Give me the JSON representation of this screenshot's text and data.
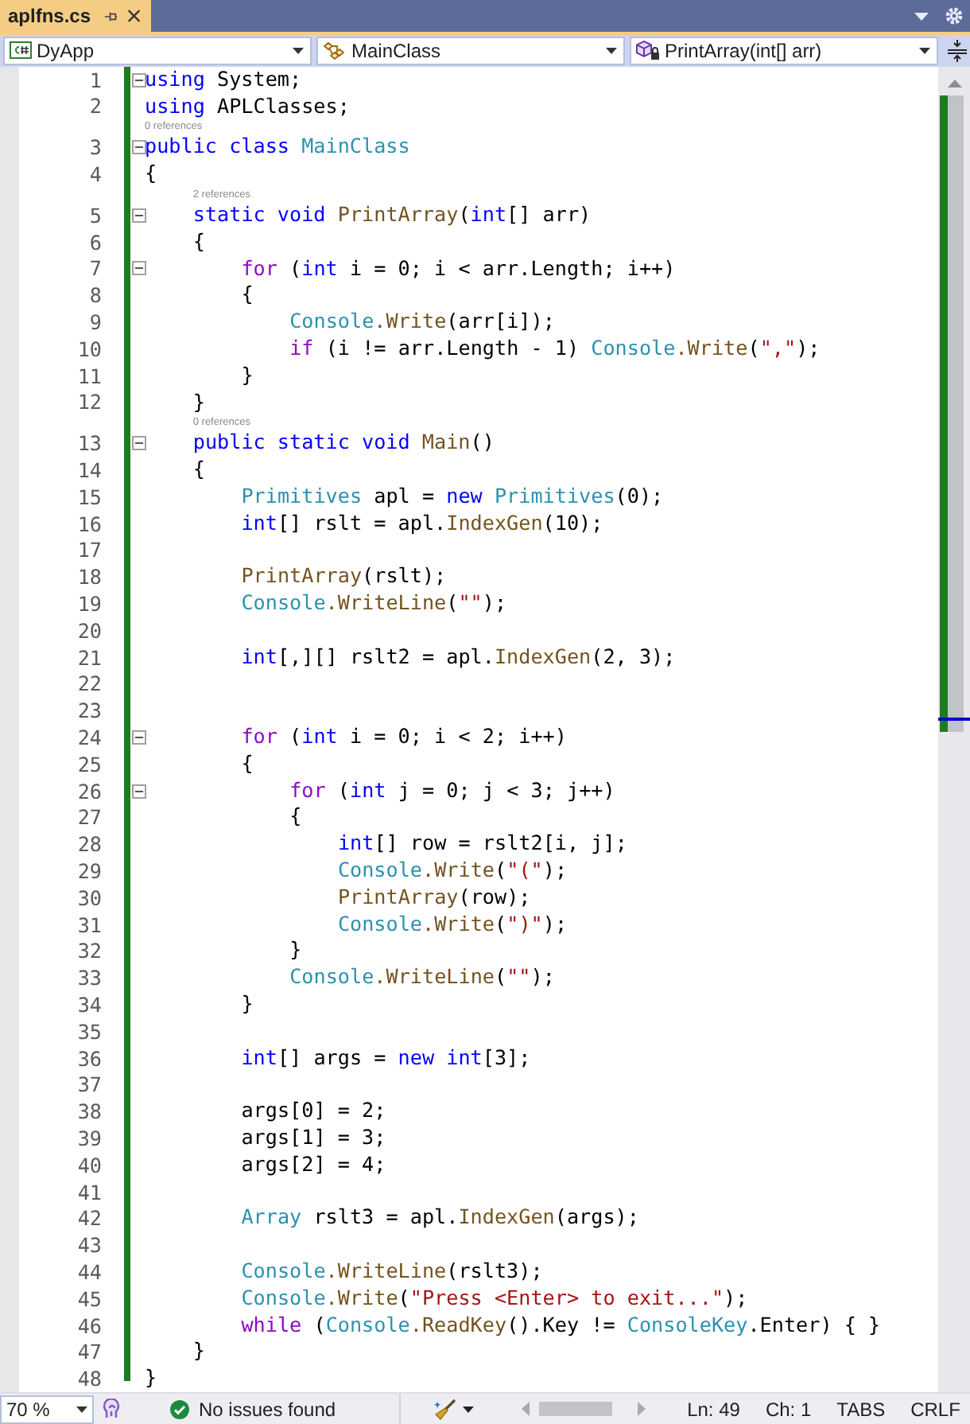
{
  "tab": {
    "title": "aplfns.cs",
    "selected": true
  },
  "nav": [
    {
      "kind": "project",
      "text": "DyApp"
    },
    {
      "kind": "class",
      "text": "MainClass"
    },
    {
      "kind": "method",
      "text": "PrintArray(int[] arr)"
    }
  ],
  "lines": [
    {
      "n": "1",
      "fold": true,
      "tokens": [
        {
          "text": "using ",
          "kind": "keyword"
        },
        {
          "text": "System;",
          "kind": "plain"
        }
      ]
    },
    {
      "n": "2",
      "tokens": [
        {
          "text": "using ",
          "kind": "keyword"
        },
        {
          "text": "APLClasses;",
          "kind": "plain"
        }
      ]
    },
    {
      "n": "3",
      "lens": "0 references",
      "fold": true,
      "tokens": [
        {
          "text": "public class ",
          "kind": "keyword"
        },
        {
          "text": "MainClass",
          "kind": "type"
        }
      ]
    },
    {
      "n": "4",
      "tokens": [
        {
          "text": "{",
          "kind": "plain"
        }
      ]
    },
    {
      "n": "5",
      "lens": "2 references",
      "fold": true,
      "tokens": [
        {
          "text": "    static void ",
          "kind": "keyword"
        },
        {
          "text": "PrintArray",
          "kind": "method"
        },
        {
          "text": "(",
          "kind": "plain"
        },
        {
          "text": "int",
          "kind": "keyword"
        },
        {
          "text": "[] arr)",
          "kind": "plain"
        }
      ]
    },
    {
      "n": "6",
      "tokens": [
        {
          "text": "    {",
          "kind": "plain"
        }
      ]
    },
    {
      "n": "7",
      "fold": true,
      "tokens": [
        {
          "text": "        for",
          "kind": "control"
        },
        {
          "text": " (",
          "kind": "plain"
        },
        {
          "text": "int",
          "kind": "keyword"
        },
        {
          "text": " i = 0; i < arr.Length; i++)",
          "kind": "plain"
        }
      ]
    },
    {
      "n": "8",
      "tokens": [
        {
          "text": "        {",
          "kind": "plain"
        }
      ]
    },
    {
      "n": "9",
      "tokens": [
        {
          "text": "            Console",
          "kind": "type"
        },
        {
          "text": ".Write",
          "kind": "method"
        },
        {
          "text": "(arr[i]);",
          "kind": "plain"
        }
      ]
    },
    {
      "n": "10",
      "tokens": [
        {
          "text": "            if",
          "kind": "control"
        },
        {
          "text": " (i != arr.Length - 1) ",
          "kind": "plain"
        },
        {
          "text": "Console",
          "kind": "type"
        },
        {
          "text": ".Write",
          "kind": "method"
        },
        {
          "text": "(",
          "kind": "plain"
        },
        {
          "text": "\",\"",
          "kind": "string"
        },
        {
          "text": ");",
          "kind": "plain"
        }
      ]
    },
    {
      "n": "11",
      "tokens": [
        {
          "text": "        }",
          "kind": "plain"
        }
      ]
    },
    {
      "n": "12",
      "tokens": [
        {
          "text": "    }",
          "kind": "plain"
        }
      ]
    },
    {
      "n": "13",
      "lens": "0 references",
      "fold": true,
      "tokens": [
        {
          "text": "    public static void ",
          "kind": "keyword"
        },
        {
          "text": "Main",
          "kind": "method"
        },
        {
          "text": "()",
          "kind": "plain"
        }
      ]
    },
    {
      "n": "14",
      "tokens": [
        {
          "text": "    {",
          "kind": "plain"
        }
      ]
    },
    {
      "n": "15",
      "tokens": [
        {
          "text": "        Primitives",
          "kind": "type"
        },
        {
          "text": " apl = ",
          "kind": "plain"
        },
        {
          "text": "new ",
          "kind": "keyword"
        },
        {
          "text": "Primitives",
          "kind": "type"
        },
        {
          "text": "(0);",
          "kind": "plain"
        }
      ]
    },
    {
      "n": "16",
      "tokens": [
        {
          "text": "        int",
          "kind": "keyword"
        },
        {
          "text": "[] rslt = apl.",
          "kind": "plain"
        },
        {
          "text": "IndexGen",
          "kind": "method"
        },
        {
          "text": "(10);",
          "kind": "plain"
        }
      ]
    },
    {
      "n": "17"
    },
    {
      "n": "18",
      "tokens": [
        {
          "text": "        PrintArray",
          "kind": "method"
        },
        {
          "text": "(rslt);",
          "kind": "plain"
        }
      ]
    },
    {
      "n": "19",
      "tokens": [
        {
          "text": "        Console",
          "kind": "type"
        },
        {
          "text": ".WriteLine",
          "kind": "method"
        },
        {
          "text": "(",
          "kind": "plain"
        },
        {
          "text": "\"\"",
          "kind": "string"
        },
        {
          "text": ");",
          "kind": "plain"
        }
      ]
    },
    {
      "n": "20"
    },
    {
      "n": "21",
      "tokens": [
        {
          "text": "        int",
          "kind": "keyword"
        },
        {
          "text": "[,][] rslt2 = apl.",
          "kind": "plain"
        },
        {
          "text": "IndexGen",
          "kind": "method"
        },
        {
          "text": "(2, 3);",
          "kind": "plain"
        }
      ]
    },
    {
      "n": "22"
    },
    {
      "n": "23"
    },
    {
      "n": "24",
      "fold": true,
      "tokens": [
        {
          "text": "        for",
          "kind": "control"
        },
        {
          "text": " (",
          "kind": "plain"
        },
        {
          "text": "int",
          "kind": "keyword"
        },
        {
          "text": " i = 0; i < 2; i++)",
          "kind": "plain"
        }
      ]
    },
    {
      "n": "25",
      "tokens": [
        {
          "text": "        {",
          "kind": "plain"
        }
      ]
    },
    {
      "n": "26",
      "fold": true,
      "tokens": [
        {
          "text": "            for",
          "kind": "control"
        },
        {
          "text": " (",
          "kind": "plain"
        },
        {
          "text": "int",
          "kind": "keyword"
        },
        {
          "text": " j = 0; j < 3; j++)",
          "kind": "plain"
        }
      ]
    },
    {
      "n": "27",
      "tokens": [
        {
          "text": "            {",
          "kind": "plain"
        }
      ]
    },
    {
      "n": "28",
      "tokens": [
        {
          "text": "                int",
          "kind": "keyword"
        },
        {
          "text": "[] row = rslt2[i, j];",
          "kind": "plain"
        }
      ]
    },
    {
      "n": "29",
      "tokens": [
        {
          "text": "                Console",
          "kind": "type"
        },
        {
          "text": ".Write",
          "kind": "method"
        },
        {
          "text": "(",
          "kind": "plain"
        },
        {
          "text": "\"(\"",
          "kind": "string"
        },
        {
          "text": ");",
          "kind": "plain"
        }
      ]
    },
    {
      "n": "30",
      "tokens": [
        {
          "text": "                PrintArray",
          "kind": "method"
        },
        {
          "text": "(row);",
          "kind": "plain"
        }
      ]
    },
    {
      "n": "31",
      "tokens": [
        {
          "text": "                Console",
          "kind": "type"
        },
        {
          "text": ".Write",
          "kind": "method"
        },
        {
          "text": "(",
          "kind": "plain"
        },
        {
          "text": "\")\"",
          "kind": "string"
        },
        {
          "text": ");",
          "kind": "plain"
        }
      ]
    },
    {
      "n": "32",
      "tokens": [
        {
          "text": "            }",
          "kind": "plain"
        }
      ]
    },
    {
      "n": "33",
      "tokens": [
        {
          "text": "            Console",
          "kind": "type"
        },
        {
          "text": ".WriteLine",
          "kind": "method"
        },
        {
          "text": "(",
          "kind": "plain"
        },
        {
          "text": "\"\"",
          "kind": "string"
        },
        {
          "text": ");",
          "kind": "plain"
        }
      ]
    },
    {
      "n": "34",
      "tokens": [
        {
          "text": "        }",
          "kind": "plain"
        }
      ]
    },
    {
      "n": "35"
    },
    {
      "n": "36",
      "tokens": [
        {
          "text": "        int",
          "kind": "keyword"
        },
        {
          "text": "[] args = ",
          "kind": "plain"
        },
        {
          "text": "new int",
          "kind": "keyword"
        },
        {
          "text": "[3];",
          "kind": "plain"
        }
      ]
    },
    {
      "n": "37"
    },
    {
      "n": "38",
      "tokens": [
        {
          "text": "        args[0] = 2;",
          "kind": "plain"
        }
      ]
    },
    {
      "n": "39",
      "tokens": [
        {
          "text": "        args[1] = 3;",
          "kind": "plain"
        }
      ]
    },
    {
      "n": "40",
      "tokens": [
        {
          "text": "        args[2] = 4;",
          "kind": "plain"
        }
      ]
    },
    {
      "n": "41"
    },
    {
      "n": "42",
      "tokens": [
        {
          "text": "        Array",
          "kind": "type"
        },
        {
          "text": " rslt3 = apl.",
          "kind": "plain"
        },
        {
          "text": "IndexGen",
          "kind": "method"
        },
        {
          "text": "(args);",
          "kind": "plain"
        }
      ]
    },
    {
      "n": "43"
    },
    {
      "n": "44",
      "tokens": [
        {
          "text": "        Console",
          "kind": "type"
        },
        {
          "text": ".WriteLine",
          "kind": "method"
        },
        {
          "text": "(rslt3);",
          "kind": "plain"
        }
      ]
    },
    {
      "n": "45",
      "tokens": [
        {
          "text": "        Console",
          "kind": "type"
        },
        {
          "text": ".Write",
          "kind": "method"
        },
        {
          "text": "(",
          "kind": "plain"
        },
        {
          "text": "\"Press <Enter> to exit...\"",
          "kind": "string"
        },
        {
          "text": ");",
          "kind": "plain"
        }
      ]
    },
    {
      "n": "46",
      "tokens": [
        {
          "text": "        while",
          "kind": "control"
        },
        {
          "text": " (",
          "kind": "plain"
        },
        {
          "text": "Console",
          "kind": "type"
        },
        {
          "text": ".ReadKey",
          "kind": "method"
        },
        {
          "text": "().Key != ",
          "kind": "plain"
        },
        {
          "text": "ConsoleKey",
          "kind": "type"
        },
        {
          "text": ".Enter) { }",
          "kind": "plain"
        }
      ]
    },
    {
      "n": "47",
      "tokens": [
        {
          "text": "    }",
          "kind": "plain"
        }
      ]
    },
    {
      "n": "48",
      "tokens": [
        {
          "text": "}",
          "kind": "plain"
        }
      ]
    }
  ],
  "status": {
    "zoom": "70 %",
    "issues": "No issues found",
    "ln": "Ln: 49",
    "ch": "Ch: 1",
    "indent": "TABS",
    "eol": "CRLF"
  }
}
